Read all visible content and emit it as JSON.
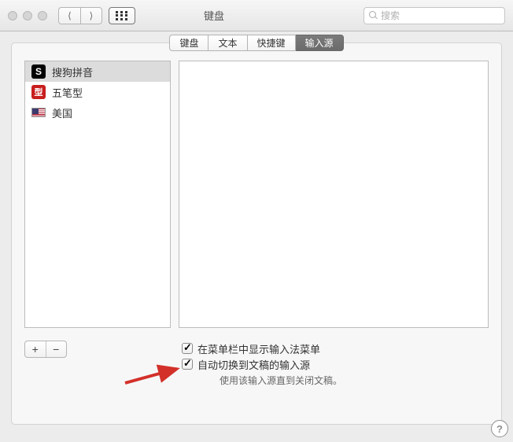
{
  "window": {
    "title": "键盘"
  },
  "search": {
    "placeholder": "搜索"
  },
  "tabs": {
    "items": [
      "键盘",
      "文本",
      "快捷键",
      "输入源"
    ],
    "selected": 3
  },
  "sources": [
    {
      "label": "搜狗拼音",
      "iconGlyph": "S",
      "iconKind": "s",
      "selected": true
    },
    {
      "label": "五笔型",
      "iconGlyph": "型",
      "iconKind": "w",
      "selected": false
    },
    {
      "label": "美国",
      "iconGlyph": "",
      "iconKind": "flag",
      "selected": false
    }
  ],
  "addremove": {
    "add": "+",
    "remove": "−"
  },
  "options": {
    "line1": "在菜单栏中显示输入法菜单",
    "line2": "自动切换到文稿的输入源",
    "hint": "使用该输入源直到关闭文稿。"
  },
  "help": "?"
}
